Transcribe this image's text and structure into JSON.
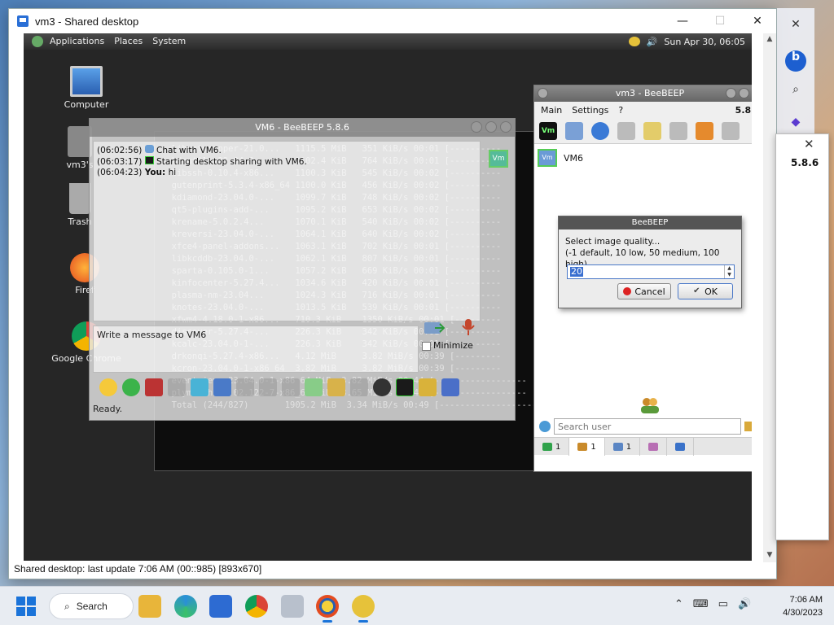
{
  "host": {
    "title": "vm3 - Shared desktop",
    "status": "Shared desktop: last update 7:06 AM (00::985) [893x670]",
    "min": "—",
    "max": "☐",
    "close": "✕"
  },
  "gnome_panel": {
    "menus": [
      "Applications",
      "Places",
      "System"
    ],
    "clock": "Sun Apr 30, 06:05"
  },
  "desktop_icons": [
    "Computer",
    "vm3's",
    "Trash",
    "Firef",
    "Google Chrome"
  ],
  "terminal": {
    "lines": [
      "                                                                    ",
      "  libsatwrapper-21.0...   1115.5 MiB   351 KiB/s 00:01 [----------",
      "  kdeutils-23.04.0-...    1102.4 KiB   764 KiB/s 00:01 [----------",
      "  libssh-0.10.4-x86...    1100.3 KiB   545 KiB/s 00:02 [----------",
      "  gutenprint-5.3.4-x86_64 1100.0 KiB   456 KiB/s 00:02 [----------",
      "  kdiamond-23.04.0-...    1099.7 KiB   748 KiB/s 00:02 [----------",
      "  qt5-plugins-add-...     1095.2 KiB   653 KiB/s 00:02 [----------",
      "  krename-5.0.2.4...      1070.1 KiB   540 KiB/s 00:02 [----------",
      "  kreversi-23.04.0-...    1064.1 KiB   640 KiB/s 00:02 [----------",
      "  xfce4-panel-addons...   1063.1 KiB   702 KiB/s 00:01 [----------",
      "  libkcddb-23.04.0-...    1062.1 KiB   807 KiB/s 00:01 [----------",
      "  sparta-0.105.0-1...     1057.2 KiB   669 KiB/s 00:01 [----------",
      "  kinfocenter-5.27.4...   1034.6 KiB   420 KiB/s 00:01 [----------",
      "  plasma-nm-23.04...      1024.3 KiB   716 KiB/s 00:01 [----------",
      "  knotes-23.04.0-...      1013.5 KiB   539 KiB/s 00:01 [----------",
      "  xfwm4-4.18.0-1-x86...   710.3 KiB    1350 KiB/s 00:01 [---------",
      "  discover-5.27.4-...     226.3 KiB    342 KiB/s 00:01 [----------",
      "  kcalc-23.04.0-1-...     226.3 KiB    342 KiB/s 00:01 [----------",
      "  drkonqi-5.27.4-x86...   4.12 MiB     3.82 MiB/s 00:39 [---------",
      "  kcron-23.04.0-1-x86 64  3.82 MiB     3.82 MiB/s 00:39 [---------",
      "  eventviews-23.04.0-1-x86 64 MiB  3.82 MiB/s 00:44 [------------------",
      "  plymouth-22.02.122-7-x86_64 MiB  3.65 MiB/s 00:45 [------------------",
      "  Total (244/827)       1905.2 MiB  3.34 MiB/s 00:49 [-------------------C ]  91%"
    ]
  },
  "chat": {
    "title": "VM6 - BeeBEEP 5.8.6",
    "avatar": "Vm",
    "messages": [
      {
        "time": "(06:02:56)",
        "text": "Chat with VM6."
      },
      {
        "time": "(06:03:17)",
        "text": "Starting desktop sharing with VM6."
      },
      {
        "time": "(06:04:23)",
        "who": "You:",
        "text": "hi"
      }
    ],
    "input_placeholder": "Write a message to VM6",
    "minimize": "Minimize",
    "status": "Ready."
  },
  "beebeep": {
    "title": "vm3 - BeeBEEP",
    "menu": [
      "Main",
      "Settings",
      "?"
    ],
    "version": "5.8.6",
    "toolbar_vm": "Vm",
    "user": {
      "name": "VM6",
      "avatar": "Vm"
    },
    "search_placeholder": "Search user",
    "tabs": [
      {
        "count": "1",
        "color": "#2fa24a"
      },
      {
        "count": "1",
        "color": "#c98a2a"
      },
      {
        "count": "1",
        "color": "#5b86c4"
      },
      {
        "count": "",
        "color": "#b86fb4"
      },
      {
        "count": "",
        "color": "#3a72c9"
      }
    ]
  },
  "dialog": {
    "title": "BeeBEEP",
    "line1": "Select image quality...",
    "line2": "(-1 default, 10 low, 50 medium, 100 high)",
    "value": "20",
    "cancel": "Cancel",
    "ok": "OK"
  },
  "right_app": {
    "version": "5.8.6",
    "close": "✕"
  },
  "taskbar": {
    "search": "Search",
    "time": "7:06 AM",
    "date": "4/30/2023"
  },
  "colors": {
    "accent": "#1a73d9",
    "chat_window": "#e8e8e8",
    "terminal_bg": "#0d0d0d"
  }
}
